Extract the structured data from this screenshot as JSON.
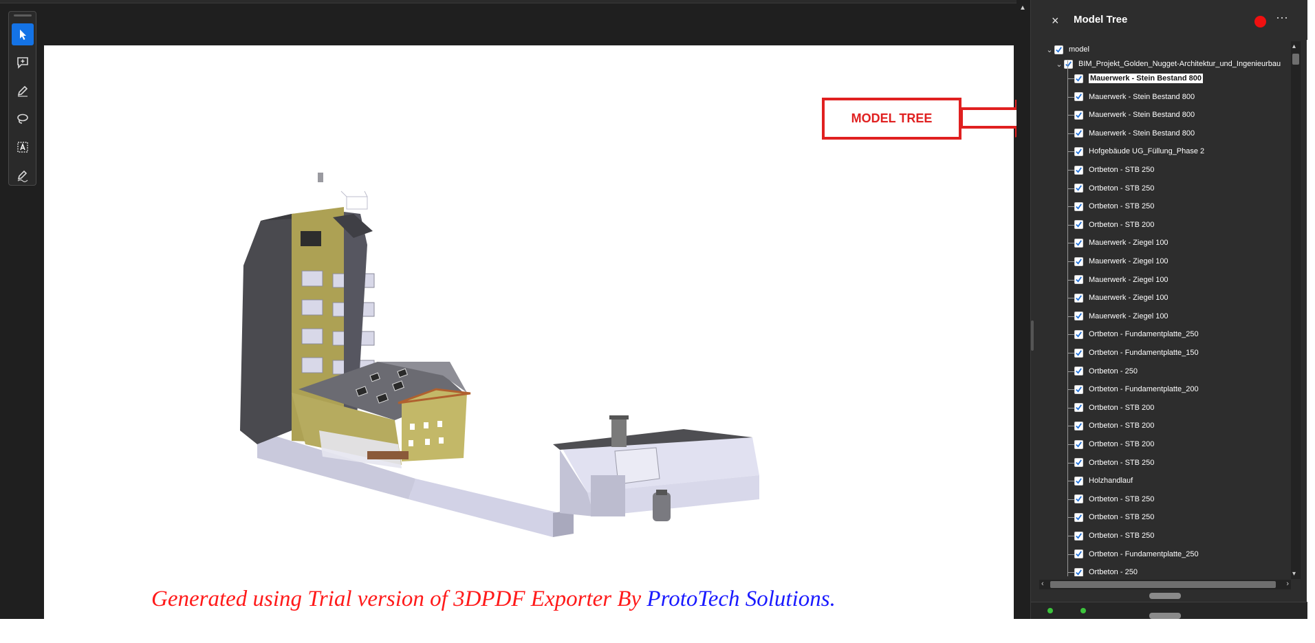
{
  "toolbar": {
    "tools": [
      {
        "name": "select-tool",
        "icon": "arrow-pointer-icon",
        "active": true
      },
      {
        "name": "add-comment-tool",
        "icon": "comment-plus-icon",
        "active": false
      },
      {
        "name": "highlight-tool",
        "icon": "pen-icon",
        "active": false
      },
      {
        "name": "draw-tool",
        "icon": "lasso-icon",
        "active": false
      },
      {
        "name": "text-select-tool",
        "icon": "text-box-icon",
        "active": false
      },
      {
        "name": "sign-tool",
        "icon": "signature-icon",
        "active": false
      }
    ]
  },
  "document": {
    "watermark_red": "Generated using Trial version of 3DPDF Exporter By ",
    "watermark_blue": "ProtoTech Solutions."
  },
  "callout": {
    "label": "MODEL TREE",
    "color": "#e02020"
  },
  "panel": {
    "close_label": "×",
    "title": "Model Tree",
    "more_label": "⋯",
    "record_color": "#f01010"
  },
  "tree": {
    "root": {
      "label": "model",
      "checked": true
    },
    "project": {
      "label": "BIM_Projekt_Golden_Nugget-Architektur_und_Ingenieurbau",
      "checked": true
    },
    "items": [
      {
        "label": "Mauerwerk - Stein Bestand 800",
        "selected": true
      },
      {
        "label": "Mauerwerk - Stein Bestand 800"
      },
      {
        "label": "Mauerwerk - Stein Bestand 800"
      },
      {
        "label": "Mauerwerk - Stein Bestand 800"
      },
      {
        "label": "Hofgebäude UG_Füllung_Phase 2"
      },
      {
        "label": "Ortbeton - STB 250"
      },
      {
        "label": "Ortbeton - STB 250"
      },
      {
        "label": "Ortbeton - STB 250"
      },
      {
        "label": "Ortbeton - STB 200"
      },
      {
        "label": "Mauerwerk - Ziegel 100"
      },
      {
        "label": "Mauerwerk - Ziegel 100"
      },
      {
        "label": "Mauerwerk - Ziegel 100"
      },
      {
        "label": "Mauerwerk - Ziegel 100"
      },
      {
        "label": "Mauerwerk - Ziegel 100"
      },
      {
        "label": "Ortbeton - Fundamentplatte_250"
      },
      {
        "label": "Ortbeton - Fundamentplatte_150"
      },
      {
        "label": "Ortbeton - 250"
      },
      {
        "label": "Ortbeton - Fundamentplatte_200"
      },
      {
        "label": "Ortbeton - STB 200"
      },
      {
        "label": "Ortbeton - STB 200"
      },
      {
        "label": "Ortbeton - STB 200"
      },
      {
        "label": "Ortbeton - STB 250"
      },
      {
        "label": "Holzhandlauf"
      },
      {
        "label": "Ortbeton - STB 250"
      },
      {
        "label": "Ortbeton - STB 250"
      },
      {
        "label": "Ortbeton - STB 250"
      },
      {
        "label": "Ortbeton - Fundamentplatte_250"
      },
      {
        "label": "Ortbeton - 250"
      }
    ]
  }
}
